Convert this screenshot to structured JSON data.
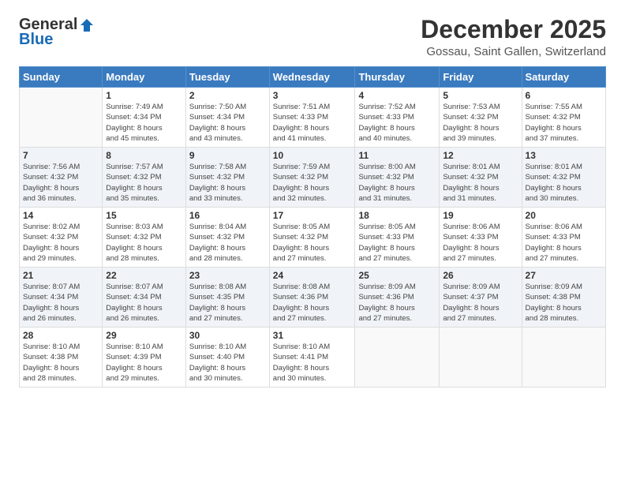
{
  "header": {
    "logo_general": "General",
    "logo_blue": "Blue",
    "title": "December 2025",
    "subtitle": "Gossau, Saint Gallen, Switzerland"
  },
  "days_of_week": [
    "Sunday",
    "Monday",
    "Tuesday",
    "Wednesday",
    "Thursday",
    "Friday",
    "Saturday"
  ],
  "weeks": [
    [
      {
        "day": "",
        "sunrise": "",
        "sunset": "",
        "daylight": ""
      },
      {
        "day": "1",
        "sunrise": "Sunrise: 7:49 AM",
        "sunset": "Sunset: 4:34 PM",
        "daylight": "Daylight: 8 hours and 45 minutes."
      },
      {
        "day": "2",
        "sunrise": "Sunrise: 7:50 AM",
        "sunset": "Sunset: 4:34 PM",
        "daylight": "Daylight: 8 hours and 43 minutes."
      },
      {
        "day": "3",
        "sunrise": "Sunrise: 7:51 AM",
        "sunset": "Sunset: 4:33 PM",
        "daylight": "Daylight: 8 hours and 41 minutes."
      },
      {
        "day": "4",
        "sunrise": "Sunrise: 7:52 AM",
        "sunset": "Sunset: 4:33 PM",
        "daylight": "Daylight: 8 hours and 40 minutes."
      },
      {
        "day": "5",
        "sunrise": "Sunrise: 7:53 AM",
        "sunset": "Sunset: 4:32 PM",
        "daylight": "Daylight: 8 hours and 39 minutes."
      },
      {
        "day": "6",
        "sunrise": "Sunrise: 7:55 AM",
        "sunset": "Sunset: 4:32 PM",
        "daylight": "Daylight: 8 hours and 37 minutes."
      }
    ],
    [
      {
        "day": "7",
        "sunrise": "Sunrise: 7:56 AM",
        "sunset": "Sunset: 4:32 PM",
        "daylight": "Daylight: 8 hours and 36 minutes."
      },
      {
        "day": "8",
        "sunrise": "Sunrise: 7:57 AM",
        "sunset": "Sunset: 4:32 PM",
        "daylight": "Daylight: 8 hours and 35 minutes."
      },
      {
        "day": "9",
        "sunrise": "Sunrise: 7:58 AM",
        "sunset": "Sunset: 4:32 PM",
        "daylight": "Daylight: 8 hours and 33 minutes."
      },
      {
        "day": "10",
        "sunrise": "Sunrise: 7:59 AM",
        "sunset": "Sunset: 4:32 PM",
        "daylight": "Daylight: 8 hours and 32 minutes."
      },
      {
        "day": "11",
        "sunrise": "Sunrise: 8:00 AM",
        "sunset": "Sunset: 4:32 PM",
        "daylight": "Daylight: 8 hours and 31 minutes."
      },
      {
        "day": "12",
        "sunrise": "Sunrise: 8:01 AM",
        "sunset": "Sunset: 4:32 PM",
        "daylight": "Daylight: 8 hours and 31 minutes."
      },
      {
        "day": "13",
        "sunrise": "Sunrise: 8:01 AM",
        "sunset": "Sunset: 4:32 PM",
        "daylight": "Daylight: 8 hours and 30 minutes."
      }
    ],
    [
      {
        "day": "14",
        "sunrise": "Sunrise: 8:02 AM",
        "sunset": "Sunset: 4:32 PM",
        "daylight": "Daylight: 8 hours and 29 minutes."
      },
      {
        "day": "15",
        "sunrise": "Sunrise: 8:03 AM",
        "sunset": "Sunset: 4:32 PM",
        "daylight": "Daylight: 8 hours and 28 minutes."
      },
      {
        "day": "16",
        "sunrise": "Sunrise: 8:04 AM",
        "sunset": "Sunset: 4:32 PM",
        "daylight": "Daylight: 8 hours and 28 minutes."
      },
      {
        "day": "17",
        "sunrise": "Sunrise: 8:05 AM",
        "sunset": "Sunset: 4:32 PM",
        "daylight": "Daylight: 8 hours and 27 minutes."
      },
      {
        "day": "18",
        "sunrise": "Sunrise: 8:05 AM",
        "sunset": "Sunset: 4:33 PM",
        "daylight": "Daylight: 8 hours and 27 minutes."
      },
      {
        "day": "19",
        "sunrise": "Sunrise: 8:06 AM",
        "sunset": "Sunset: 4:33 PM",
        "daylight": "Daylight: 8 hours and 27 minutes."
      },
      {
        "day": "20",
        "sunrise": "Sunrise: 8:06 AM",
        "sunset": "Sunset: 4:33 PM",
        "daylight": "Daylight: 8 hours and 27 minutes."
      }
    ],
    [
      {
        "day": "21",
        "sunrise": "Sunrise: 8:07 AM",
        "sunset": "Sunset: 4:34 PM",
        "daylight": "Daylight: 8 hours and 26 minutes."
      },
      {
        "day": "22",
        "sunrise": "Sunrise: 8:07 AM",
        "sunset": "Sunset: 4:34 PM",
        "daylight": "Daylight: 8 hours and 26 minutes."
      },
      {
        "day": "23",
        "sunrise": "Sunrise: 8:08 AM",
        "sunset": "Sunset: 4:35 PM",
        "daylight": "Daylight: 8 hours and 27 minutes."
      },
      {
        "day": "24",
        "sunrise": "Sunrise: 8:08 AM",
        "sunset": "Sunset: 4:36 PM",
        "daylight": "Daylight: 8 hours and 27 minutes."
      },
      {
        "day": "25",
        "sunrise": "Sunrise: 8:09 AM",
        "sunset": "Sunset: 4:36 PM",
        "daylight": "Daylight: 8 hours and 27 minutes."
      },
      {
        "day": "26",
        "sunrise": "Sunrise: 8:09 AM",
        "sunset": "Sunset: 4:37 PM",
        "daylight": "Daylight: 8 hours and 27 minutes."
      },
      {
        "day": "27",
        "sunrise": "Sunrise: 8:09 AM",
        "sunset": "Sunset: 4:38 PM",
        "daylight": "Daylight: 8 hours and 28 minutes."
      }
    ],
    [
      {
        "day": "28",
        "sunrise": "Sunrise: 8:10 AM",
        "sunset": "Sunset: 4:38 PM",
        "daylight": "Daylight: 8 hours and 28 minutes."
      },
      {
        "day": "29",
        "sunrise": "Sunrise: 8:10 AM",
        "sunset": "Sunset: 4:39 PM",
        "daylight": "Daylight: 8 hours and 29 minutes."
      },
      {
        "day": "30",
        "sunrise": "Sunrise: 8:10 AM",
        "sunset": "Sunset: 4:40 PM",
        "daylight": "Daylight: 8 hours and 30 minutes."
      },
      {
        "day": "31",
        "sunrise": "Sunrise: 8:10 AM",
        "sunset": "Sunset: 4:41 PM",
        "daylight": "Daylight: 8 hours and 30 minutes."
      },
      {
        "day": "",
        "sunrise": "",
        "sunset": "",
        "daylight": ""
      },
      {
        "day": "",
        "sunrise": "",
        "sunset": "",
        "daylight": ""
      },
      {
        "day": "",
        "sunrise": "",
        "sunset": "",
        "daylight": ""
      }
    ]
  ]
}
